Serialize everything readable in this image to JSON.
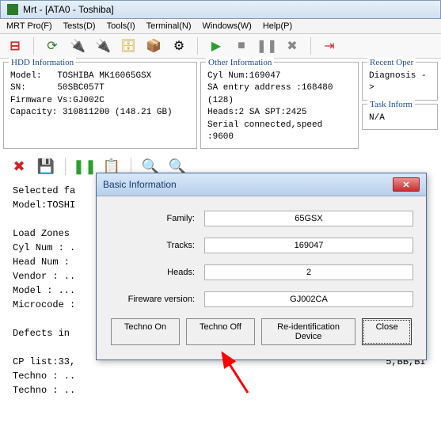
{
  "window": {
    "title": "Mrt - [ATA0 - Toshiba]"
  },
  "menu": {
    "mrtpro": "MRT Pro(F)",
    "tests": "Tests(D)",
    "tools": "Tools(I)",
    "terminal": "Terminal(N)",
    "windows": "Windows(W)",
    "help": "Help(P)"
  },
  "hdd": {
    "legend": "HDD Information",
    "model_l": "Model:",
    "model": "TOSHIBA MK16065GSX",
    "sn_l": "SN:",
    "sn": "50SBC057T",
    "fw_l": "Firmware Vs:",
    "fw": "GJ002C",
    "cap_l": "Capacity:",
    "cap": "310811200 (148.21 GB)"
  },
  "other": {
    "legend": "Other Information",
    "cyl": "Cyl Num:169047",
    "sa": "SA entry address :168480 (128)",
    "heads": "Heads:2 SA SPT:2425",
    "serial": "Serial connected,speed :9600"
  },
  "recent": {
    "legend": "Recent Oper",
    "line": "Diagnosis ->"
  },
  "task": {
    "legend": "Task Inform",
    "line": "N/A"
  },
  "console": {
    "l1": "Selected fa",
    "l2": "Model:TOSHI",
    "l3": "Load Zones ",
    "l4": "Cyl Num : .",
    "l5": "Head Num : ",
    "l6": "Vendor : ..",
    "l7": "Model : ...",
    "l8": "Microcode :",
    "l9": "Defects in ",
    "l10": "CP list:33,",
    "l10b": "5,BB,BI",
    "l11": "Techno : ..",
    "l12": "Techno : .."
  },
  "dialog": {
    "title": "Basic Information",
    "family_l": "Family:",
    "family": "65GSX",
    "tracks_l": "Tracks:",
    "tracks": "169047",
    "heads_l": "Heads:",
    "heads": "2",
    "fw_l": "Fireware version:",
    "fw": "GJ002CA",
    "btn_on": "Techno On",
    "btn_off": "Techno Off",
    "btn_reid": "Re-identification Device",
    "btn_close": "Close"
  }
}
